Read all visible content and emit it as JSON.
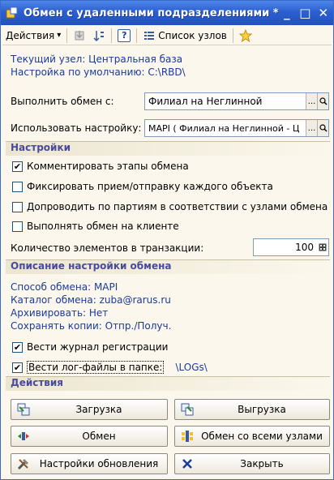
{
  "window": {
    "title": "Обмен с удаленными подразделениями *",
    "minimize_glyph": "_",
    "maximize_glyph": "□",
    "close_glyph": "✕"
  },
  "toolbar": {
    "actions_label": "Действия",
    "actions_arrow": "▾",
    "help_label": "?",
    "nodes_label": "Список узлов"
  },
  "info": {
    "current_node": "Текущий узел: Центральная база",
    "default_setting": "Настройка по умолчанию: C:\\RBD\\"
  },
  "form": {
    "exchange_with_label": "Выполнить обмен с:",
    "exchange_with_value": "Филиал на Неглинной",
    "use_setting_label": "Использовать настройку:",
    "use_setting_value": "MAPI ( Филиал на Неглинной - Ц",
    "ellipsis": "...",
    "search": "🔍"
  },
  "settings": {
    "header": "Настройки",
    "options": [
      {
        "label": "Комментировать этапы обмена",
        "checked": true
      },
      {
        "label": "Фиксировать прием/отправку каждого объекта",
        "checked": false
      },
      {
        "label": "Допроводить по партиям в соответствии с узлами обмена",
        "checked": false
      },
      {
        "label": "Выполнять обмен на клиенте",
        "checked": false
      }
    ],
    "tx_label": "Количество элементов в транзакции:",
    "tx_value": "100"
  },
  "description": {
    "header": "Описание настройки обмена",
    "lines": [
      "Способ обмена: MAPI",
      "Каталог обмена: zuba@rarus.ru",
      "Архивировать: Нет",
      "Сохранять копии: Отпр./Получ."
    ],
    "log_journal_label": "Вести журнал регистрации",
    "log_journal_checked": true,
    "log_files_label": "Вести лог-файлы в папке:",
    "log_files_checked": true,
    "log_folder": "\\LOGs\\"
  },
  "actions": {
    "header": "Действия",
    "import_label": "Загрузка",
    "export_label": "Выгрузка",
    "exchange_label": "Обмен",
    "exchange_all_label": "Обмен со всеми узлами",
    "update_settings_label": "Настройки обновления",
    "close_label": "Закрыть"
  }
}
